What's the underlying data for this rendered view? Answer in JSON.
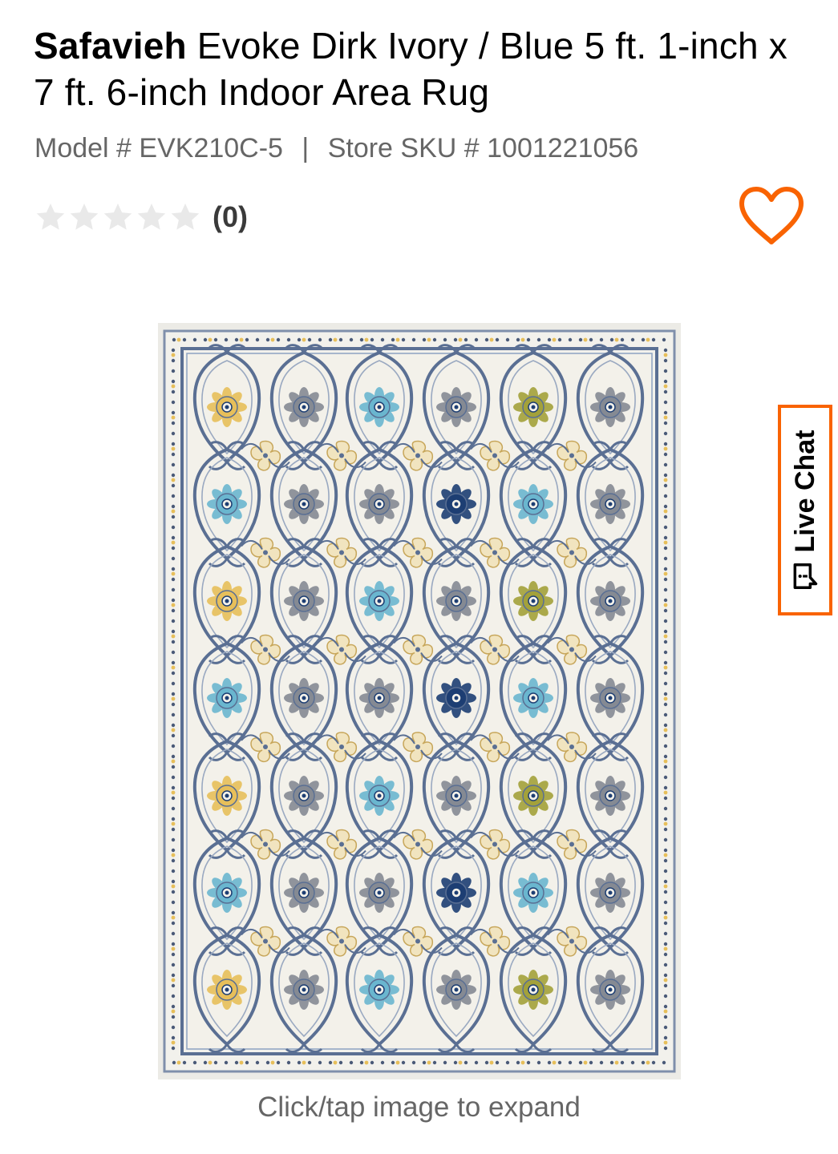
{
  "product": {
    "brand": "Safavieh",
    "title": "Evoke Dirk Ivory / Blue 5 ft. 1-inch x 7 ft. 6-inch Indoor Area Rug",
    "model_label": "Model # EVK210C-5",
    "separator": "|",
    "sku_label": "Store SKU # 1001221056"
  },
  "rating": {
    "stars_filled": 0,
    "stars_total": 5,
    "count": "(0)"
  },
  "icons": {
    "favorite": "heart-outline-icon",
    "star": "star-icon",
    "chat": "chat-bubble-icon"
  },
  "media": {
    "image_alt": "Safavieh Evoke Dirk Ivory / Blue Area Rug",
    "caption": "Click/tap image to expand"
  },
  "live_chat": {
    "label": "Live Chat"
  },
  "colors": {
    "accent": "#f96302",
    "meta_text": "#666666",
    "star_empty": "#e9e9e9",
    "rug_ivory": "#ecebe6",
    "rug_blue": "#5a6f93",
    "rug_navy": "#1d3e73",
    "rug_sky": "#6ab6cf",
    "rug_gold": "#e7bf5a",
    "rug_gray": "#858a93",
    "rug_olive": "#a3a13a"
  }
}
